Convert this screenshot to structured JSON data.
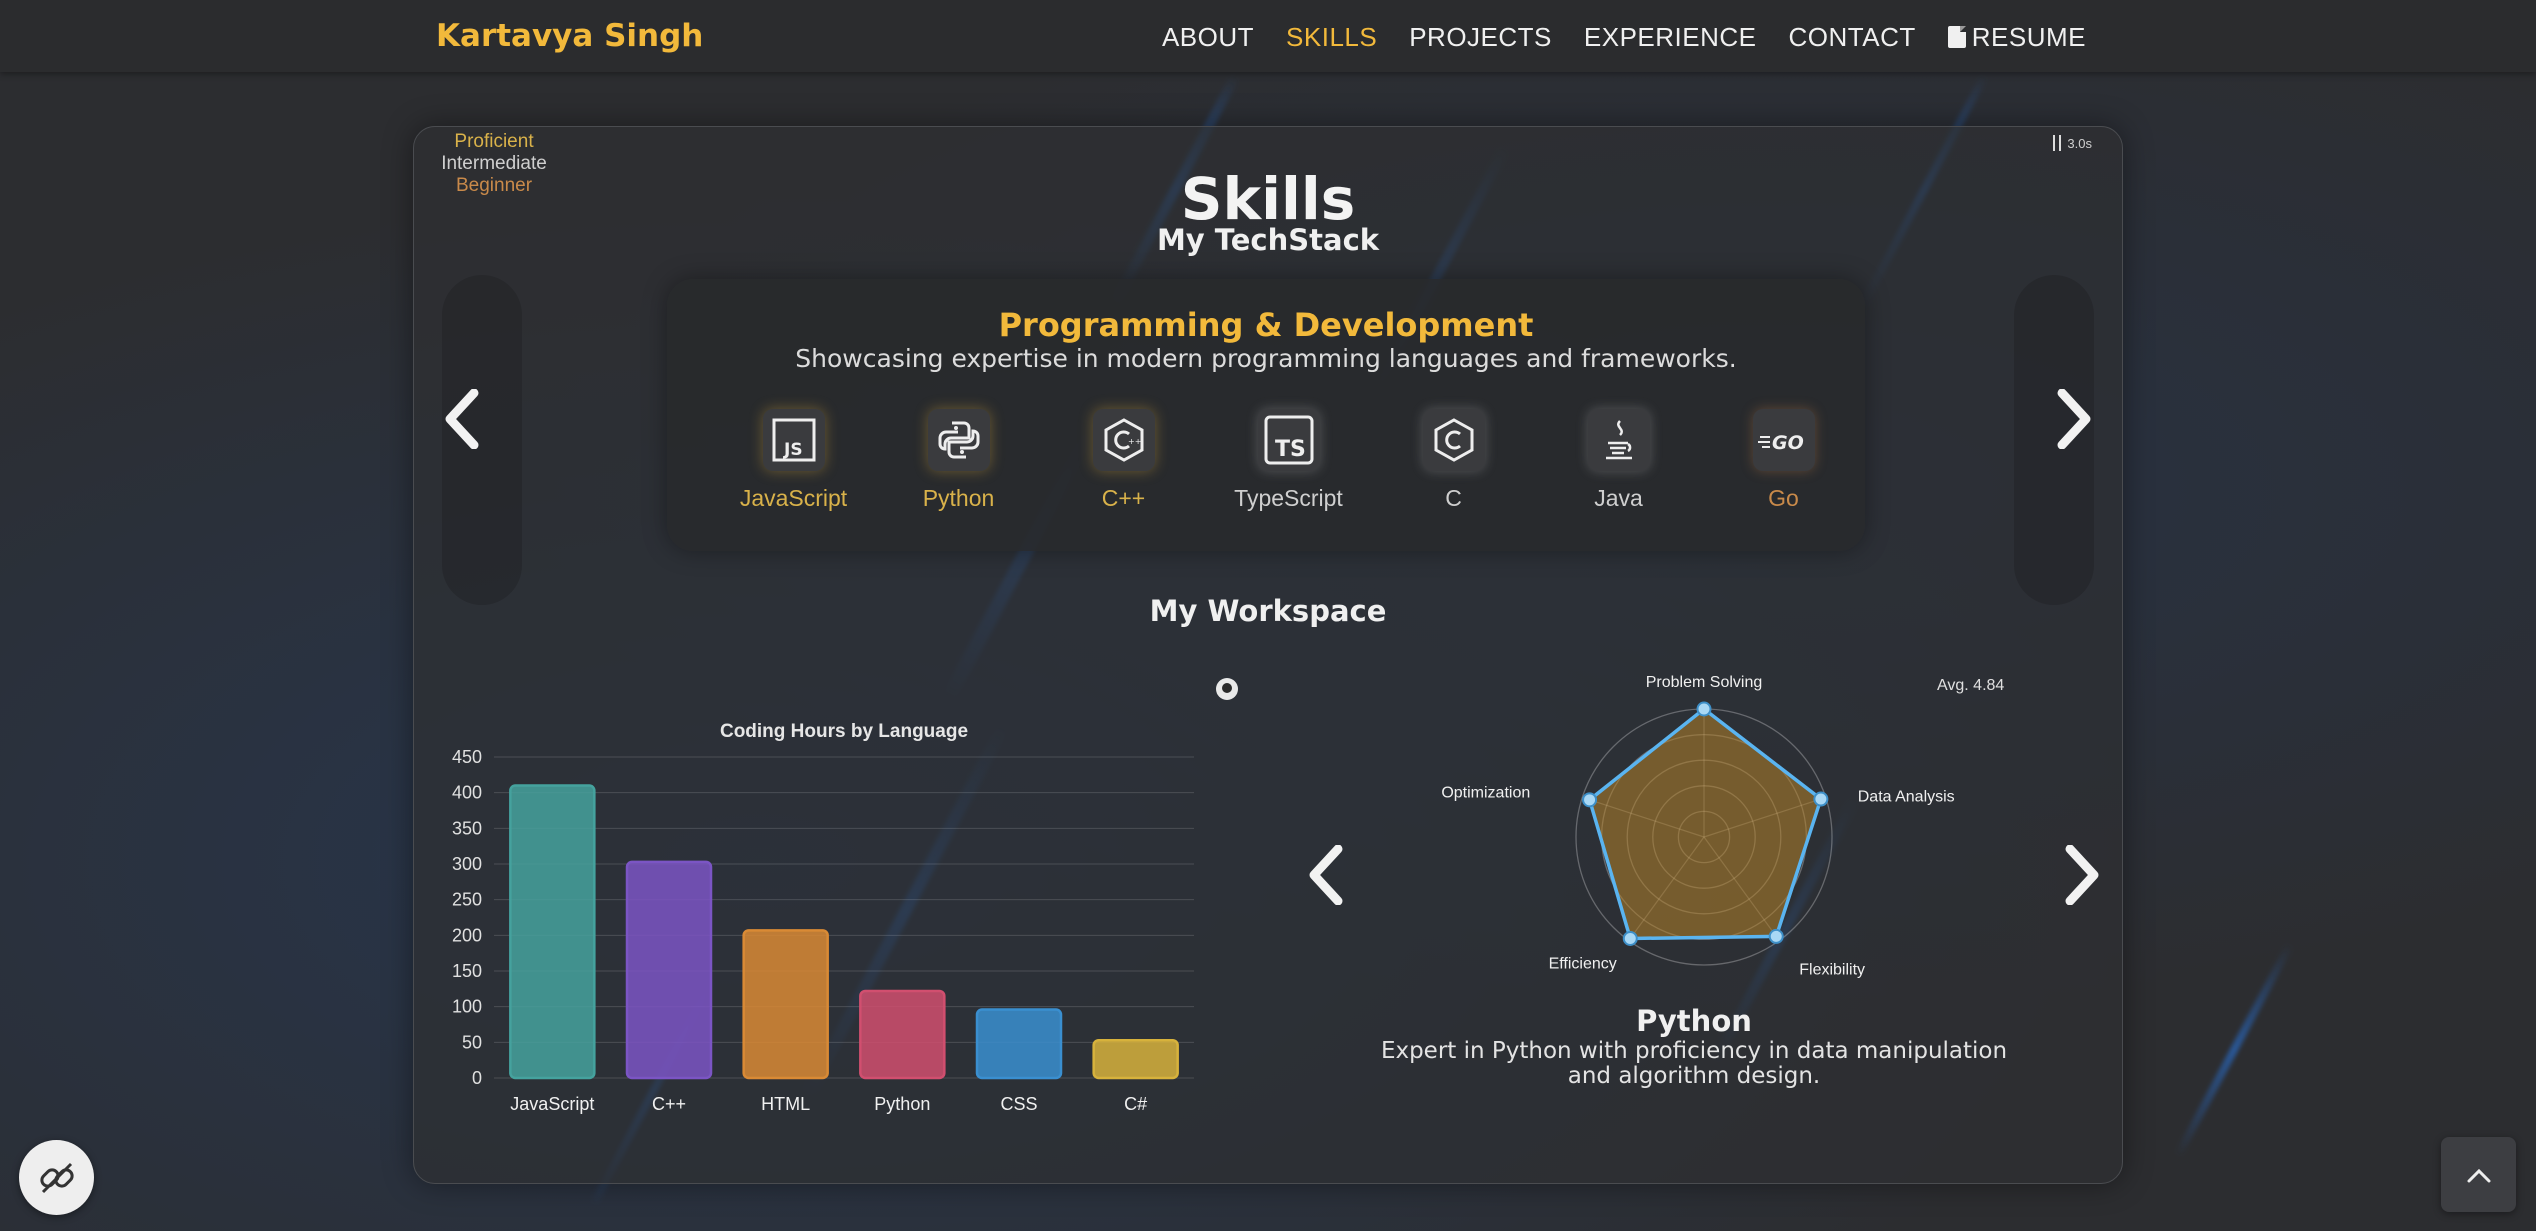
{
  "nav": {
    "brand": "Kartavya Singh",
    "items": [
      "ABOUT",
      "SKILLS",
      "PROJECTS",
      "EXPERIENCE",
      "CONTACT",
      "RESUME"
    ],
    "active": "SKILLS"
  },
  "legend": {
    "proficient": "Proficient",
    "intermediate": "Intermediate",
    "beginner": "Beginner"
  },
  "timer": {
    "label": "3.0s"
  },
  "skills": {
    "title": "Skills",
    "subtitle": "My TechStack"
  },
  "category": {
    "title": "Programming & Development",
    "description": "Showcasing expertise in modern programming languages and frameworks.",
    "languages": [
      {
        "name": "JavaScript",
        "level": "proficient",
        "icon": "javascript-icon"
      },
      {
        "name": "Python",
        "level": "proficient",
        "icon": "python-icon"
      },
      {
        "name": "C++",
        "level": "proficient",
        "icon": "cplusplus-icon"
      },
      {
        "name": "TypeScript",
        "level": "intermediate",
        "icon": "typescript-icon"
      },
      {
        "name": "C",
        "level": "intermediate",
        "icon": "c-icon"
      },
      {
        "name": "Java",
        "level": "intermediate",
        "icon": "java-icon"
      },
      {
        "name": "Go",
        "level": "beginner",
        "icon": "go-icon"
      }
    ]
  },
  "workspace": {
    "title": "My Workspace"
  },
  "chart_data": [
    {
      "type": "bar",
      "title": "Coding Hours by Language",
      "categories": [
        "JavaScript",
        "C++",
        "HTML",
        "Python",
        "CSS",
        "C#"
      ],
      "values": [
        410,
        303,
        207,
        122,
        96,
        53
      ],
      "colors": [
        "#45a29e",
        "#7b55c4",
        "#d98a35",
        "#d14f6f",
        "#3a8fd0",
        "#d7b23c"
      ],
      "ylim": [
        0,
        450
      ],
      "yticks": [
        0,
        50,
        100,
        150,
        200,
        250,
        300,
        350,
        400,
        450
      ],
      "grid": true
    },
    {
      "type": "radar",
      "title": "Python",
      "axes": [
        "Problem Solving",
        "Data Analysis",
        "Flexibility",
        "Efficiency",
        "Optimization"
      ],
      "values": [
        5,
        4.8,
        4.8,
        4.9,
        4.7
      ],
      "range": [
        0,
        5
      ]
    }
  ],
  "radar": {
    "avg_label": "Avg. 4.84",
    "title": "Python",
    "description_line1": "Expert in Python with proficiency in data manipulation",
    "description_line2": "and algorithm design."
  },
  "colors": {
    "accent": "#f2b93b",
    "background": "#2f3033"
  }
}
